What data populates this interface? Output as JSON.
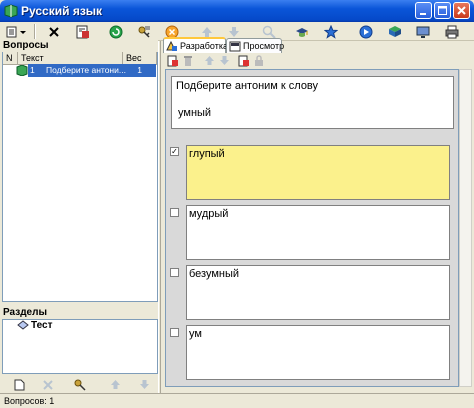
{
  "window": {
    "title": "Русский язык"
  },
  "colors": {
    "titlebar": "#0a55d8",
    "selection": "#316ac5",
    "answer_highlight": "#fbf18c"
  },
  "toolbar": {
    "icons": [
      "new-dropdown-icon",
      "delete-icon",
      "properties-icon",
      "green-refresh-icon",
      "key-icon",
      "cancel-icon",
      "find-icon",
      "arrow-up-icon",
      "arrow-down-icon",
      "search-icon",
      "hat-icon",
      "star-icon",
      "play-icon",
      "book-icon",
      "monitor-icon",
      "print-icon"
    ]
  },
  "questions": {
    "header": "Вопросы",
    "columns": [
      "N",
      "Текст",
      "Вес"
    ],
    "rows": [
      {
        "n": "1",
        "text": "Подберите антони...",
        "weight": "1"
      }
    ]
  },
  "sections": {
    "header": "Разделы",
    "items": [
      {
        "label": "Тест"
      }
    ]
  },
  "tabs": [
    {
      "label": "Разработка",
      "active": true
    },
    {
      "label": "Просмотр",
      "active": false
    }
  ],
  "question": {
    "prompt": "Подберите антоним к слову",
    "word": "умный"
  },
  "answers": [
    {
      "text": "глупый",
      "checked": true,
      "checkmark": "✓"
    },
    {
      "text": "мудрый",
      "checked": false
    },
    {
      "text": "безумный",
      "checked": false
    },
    {
      "text": "ум",
      "checked": false
    }
  ],
  "status": {
    "text": "Вопросов: 1"
  }
}
